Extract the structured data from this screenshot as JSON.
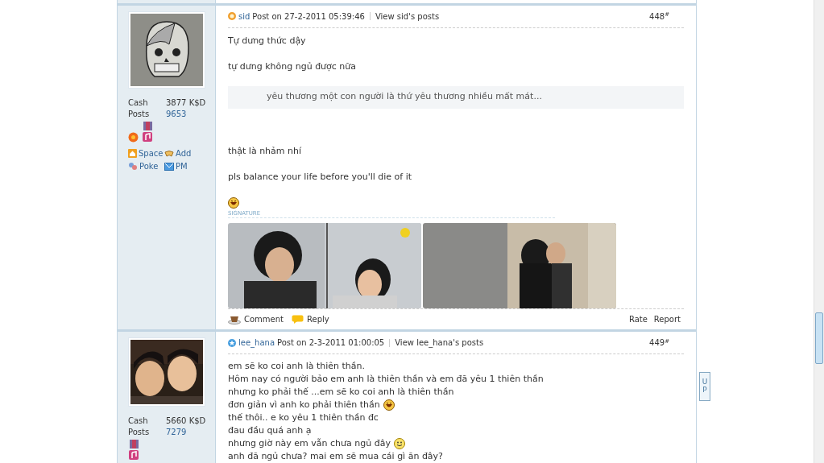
{
  "posts": [
    {
      "author": "sid",
      "badge": {
        "kind": "sun"
      },
      "avatar": {
        "kind": "picture"
      },
      "stats": [
        {
          "label": "Cash",
          "value": "3877 K$D"
        },
        {
          "label": "Posts",
          "value": "9653"
        }
      ],
      "medals": [
        {
          "kind": "flower"
        },
        {
          "kind": "medal"
        }
      ],
      "actions": [
        {
          "kind": "space",
          "label": "Space"
        },
        {
          "kind": "add",
          "label": "Add"
        },
        {
          "kind": "poke",
          "label": "Poke"
        },
        {
          "kind": "pm",
          "label": "PM"
        }
      ],
      "posted": "Post on 27-2-2011 05:39:46",
      "view_link": "View sid's posts",
      "number": "448",
      "number_mark": "#",
      "blocks": [
        {
          "kind": "para",
          "text": "Tự dưng thức dậy"
        },
        {
          "kind": "para",
          "text": "tự dưng không ngủ được nữa"
        },
        {
          "kind": "quote",
          "text": "yêu thương một con người là thứ yêu thương nhiều mất mát..."
        },
        {
          "kind": "para",
          "text": "thật là nhảm nhí"
        },
        {
          "kind": "para",
          "text": "pls balance your life before you'll die of it"
        },
        {
          "kind": "laugh"
        }
      ],
      "signature_label": "SIGNATURE",
      "signature_pictures": [
        {
          "kind": "picture"
        },
        {
          "kind": "picture"
        }
      ],
      "footer_left": [
        {
          "kind": "comment",
          "label": "Comment"
        },
        {
          "kind": "reply",
          "label": "Reply"
        }
      ],
      "footer_right": [
        "Rate",
        "Report"
      ]
    },
    {
      "author": "lee_hana",
      "badge": {
        "kind": "star"
      },
      "avatar": {
        "kind": "picture"
      },
      "stats": [
        {
          "label": "Cash",
          "value": "5660 K$D"
        },
        {
          "label": "Posts",
          "value": "7279"
        }
      ],
      "medals": [
        {
          "kind": "medal"
        }
      ],
      "posted": "Post on 2-3-2011 01:00:05",
      "view_link": "View lee_hana's posts",
      "number": "449",
      "number_mark": "#",
      "lines": [
        {
          "text": "em sẽ ko coi anh là thiên thần."
        },
        {
          "text": "Hôm nay có người bảo em anh là thiên thần và em đã yêu 1 thiên thần"
        },
        {
          "text": "nhưng ko phải thế ...em sẽ ko coi anh là thiên thần"
        },
        {
          "text": "đơn giản vì anh ko phải thiên thần",
          "emoticon": {
            "kind": "laugh"
          }
        },
        {
          "text": "thế thôi.. e ko yêu 1 thiên thần đc"
        },
        {
          "text": "đau đầu quá anh ạ"
        },
        {
          "text": "nhưng giờ này em vẫn chưa ngủ đây",
          "emoticon": {
            "kind": "smile"
          }
        },
        {
          "text": "anh đã ngủ chưa? mai em sẽ mua cái gì ăn đây?"
        }
      ]
    }
  ],
  "up_button": "UP"
}
